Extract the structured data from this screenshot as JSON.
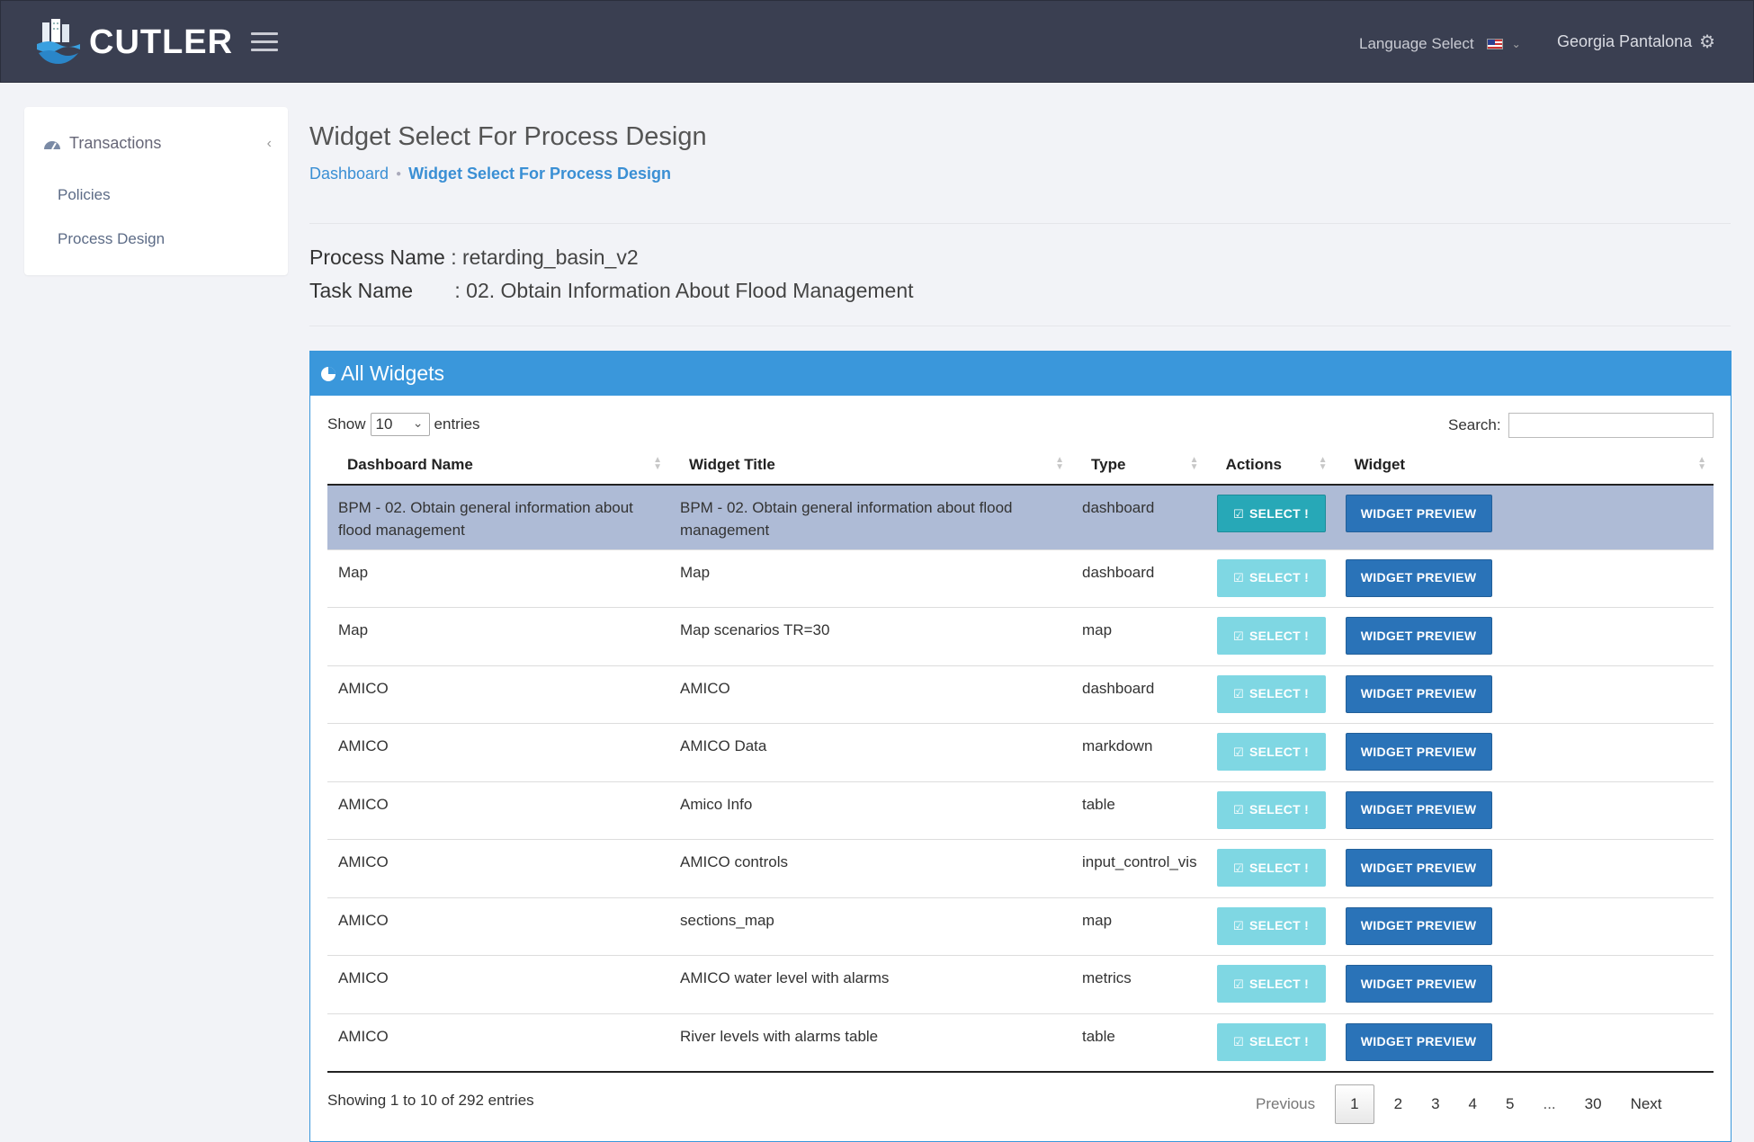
{
  "app": {
    "name": "CUTLER"
  },
  "header": {
    "language_label": "Language Select",
    "user_name": "Georgia Pantalona"
  },
  "sidebar": {
    "section_label": "Transactions",
    "items": [
      {
        "label": "Policies"
      },
      {
        "label": "Process Design"
      }
    ]
  },
  "page": {
    "title": "Widget Select For Process Design",
    "breadcrumb": [
      {
        "label": "Dashboard"
      },
      {
        "label": "Widget Select For Process Design"
      }
    ],
    "process_label": "Process Name",
    "process_value": ": retarding_basin_v2",
    "task_label": "Task Name",
    "task_value": ": 02. Obtain Information About Flood Management"
  },
  "panel": {
    "title": "All Widgets",
    "show_label": "Show",
    "show_value": "10",
    "entries_label": "entries",
    "search_label": "Search:",
    "search_value": "",
    "columns": [
      "Dashboard Name",
      "Widget Title",
      "Type",
      "Actions",
      "Widget"
    ],
    "select_label": "SELECT !",
    "preview_label": "WIDGET PREVIEW",
    "rows": [
      {
        "dashboard": "BPM - 02. Obtain general information about flood management",
        "title": "BPM - 02. Obtain general information about flood management",
        "type": "dashboard"
      },
      {
        "dashboard": "Map",
        "title": "Map",
        "type": "dashboard"
      },
      {
        "dashboard": "Map",
        "title": "Map scenarios TR=30",
        "type": "map"
      },
      {
        "dashboard": "AMICO",
        "title": "AMICO",
        "type": "dashboard"
      },
      {
        "dashboard": "AMICO",
        "title": "AMICO Data",
        "type": "markdown"
      },
      {
        "dashboard": "AMICO",
        "title": "Amico Info",
        "type": "table"
      },
      {
        "dashboard": "AMICO",
        "title": "AMICO controls",
        "type": "input_control_vis"
      },
      {
        "dashboard": "AMICO",
        "title": "sections_map",
        "type": "map"
      },
      {
        "dashboard": "AMICO",
        "title": "AMICO water level with alarms",
        "type": "metrics"
      },
      {
        "dashboard": "AMICO",
        "title": "River levels with alarms table",
        "type": "table"
      }
    ],
    "info": "Showing 1 to 10 of 292 entries",
    "pagination": {
      "previous": "Previous",
      "pages": [
        "1",
        "2",
        "3",
        "4",
        "5",
        "...",
        "30"
      ],
      "next": "Next"
    }
  }
}
